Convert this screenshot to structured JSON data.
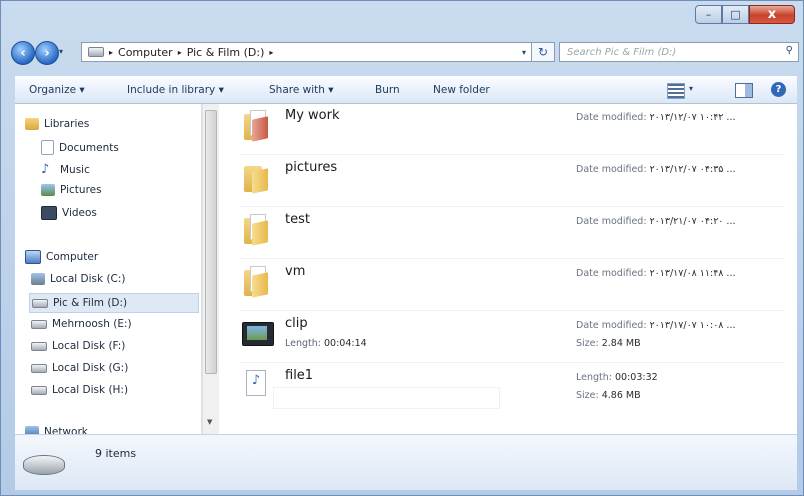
{
  "window": {
    "caption": {
      "minimize": "–",
      "maximize": "□",
      "close": "x"
    }
  },
  "nav": {
    "back_icon": "arrow-left-icon",
    "forward_icon": "arrow-right-icon",
    "breadcrumb": [
      "Computer",
      "Pic & Film (D:)"
    ],
    "separator": "▸",
    "search_placeholder": "Search Pic & Film (D:)"
  },
  "toolbar": {
    "organize": "Organize ▾",
    "include": "Include in library ▾",
    "share": "Share with ▾",
    "burn": "Burn",
    "new_folder": "New folder"
  },
  "sidebar": {
    "libraries": {
      "label": "Libraries",
      "items": [
        "Documents",
        "Music",
        "Pictures",
        "Videos"
      ]
    },
    "computer": {
      "label": "Computer",
      "items": [
        "Local Disk (C:)",
        "Pic & Film (D:)",
        "Mehrnoosh (E:)",
        "Local Disk (F:)",
        "Local Disk (G:)",
        "Local Disk (H:)"
      ],
      "selected": "Pic & Film (D:)"
    },
    "network_cut": "Network"
  },
  "files": [
    {
      "name": "My work",
      "type": "folder-doc",
      "meta_label": "Date modified:",
      "meta_value": "۲۰۱۳/۱۲/۰۷ ۱۰:۴۲ ..."
    },
    {
      "name": "pictures",
      "type": "folder",
      "meta_label": "Date modified:",
      "meta_value": "۲۰۱۳/۱۲/۰۷ ۰۴:۳۵ ..."
    },
    {
      "name": "test",
      "type": "folder-doc",
      "meta_label": "Date modified:",
      "meta_value": "۲۰۱۳/۲۱/۰۷ ۰۴:۲۰ ..."
    },
    {
      "name": "vm",
      "type": "folder-doc",
      "meta_label": "Date modified:",
      "meta_value": "۲۰۱۳/۱۷/۰۸ ۱۱:۴۸ ..."
    },
    {
      "name": "clip",
      "type": "video",
      "sub_label": "Length:",
      "sub_value": "00:04:14",
      "meta_label": "Date modified:",
      "meta_value": "۲۰۱۳/۱۷/۰۷ ۱۰:۰۸ ...",
      "meta2_label": "Size:",
      "meta2_value": "2.84 MB"
    },
    {
      "name": "file1",
      "type": "audio",
      "meta_label": "Length:",
      "meta_value": "00:03:32",
      "meta2_label": "Size:",
      "meta2_value": "4.86 MB"
    }
  ],
  "status": {
    "count": "9 items"
  },
  "colors": {
    "accent": "#2a68c4",
    "window": "#bcd1ea",
    "selection": "#dfe9f5"
  }
}
